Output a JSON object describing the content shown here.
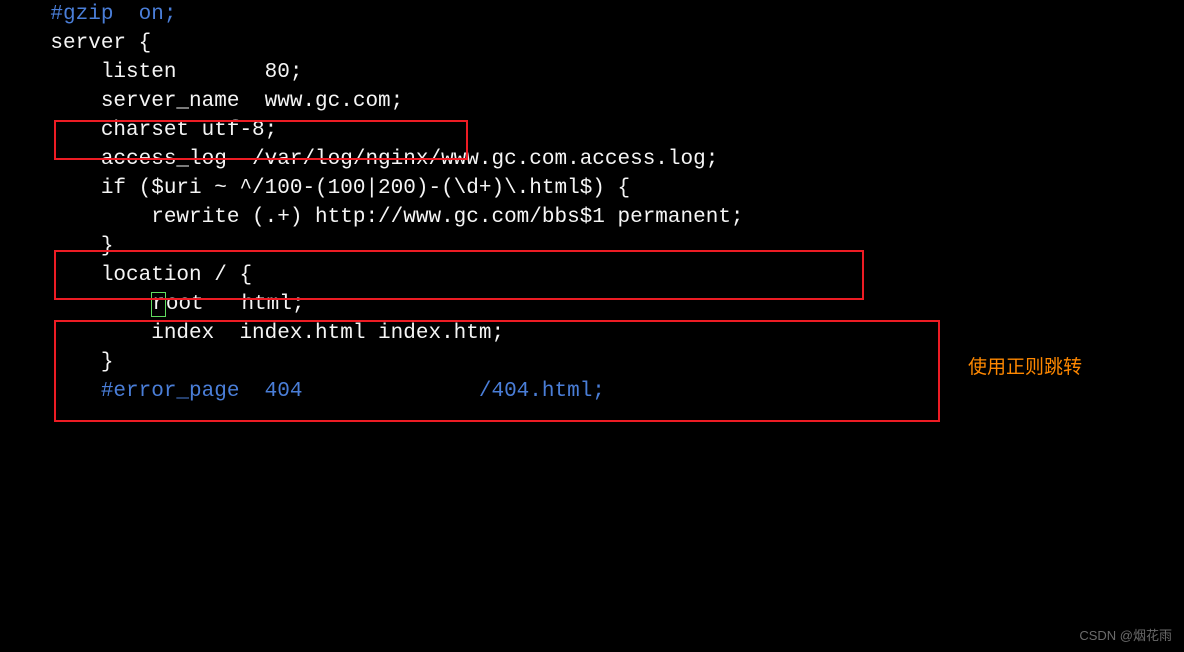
{
  "code_lines": {
    "l1": "    #gzip  on;",
    "l2": "",
    "l3": "    server {",
    "l4": "        listen       80;",
    "l5": "        server_name  www.gc.com;",
    "l6": "",
    "l7": "        charset utf-8;",
    "l8": "",
    "l9": "        access_log  /var/log/nginx/www.gc.com.access.log;",
    "l10": "",
    "l11": "        if ($uri ~ ^/100-(100|200)-(\\d+)\\.html$) {",
    "l12": "            rewrite (.+) http://www.gc.com/bbs$1 permanent;",
    "l13": "        }",
    "l14": "",
    "l15": "        location / {",
    "l16_prefix": "            ",
    "l16_cursor_char": "r",
    "l16_suffix": "oot   html;",
    "l17": "            index  index.html index.htm;",
    "l18": "        }",
    "l19": "",
    "l20": "        #error_page  404              /404.html;"
  },
  "annotation_text": "使用正则跳转",
  "watermark_text": "CSDN @烟花雨",
  "colors": {
    "background": "#000000",
    "text": "#f5f5f5",
    "comment": "#4a7ed8",
    "highlight_border": "#ed1c24",
    "annotation_color": "#ff8800",
    "cursor_border": "#5fdc5f",
    "watermark_color": "#6b6b6b"
  },
  "highlight_boxes": [
    {
      "name": "server_name_box",
      "description": "Highlights server_name directive"
    },
    {
      "name": "access_log_box",
      "description": "Highlights access_log directive"
    },
    {
      "name": "rewrite_block_box",
      "description": "Highlights if/rewrite block"
    }
  ]
}
